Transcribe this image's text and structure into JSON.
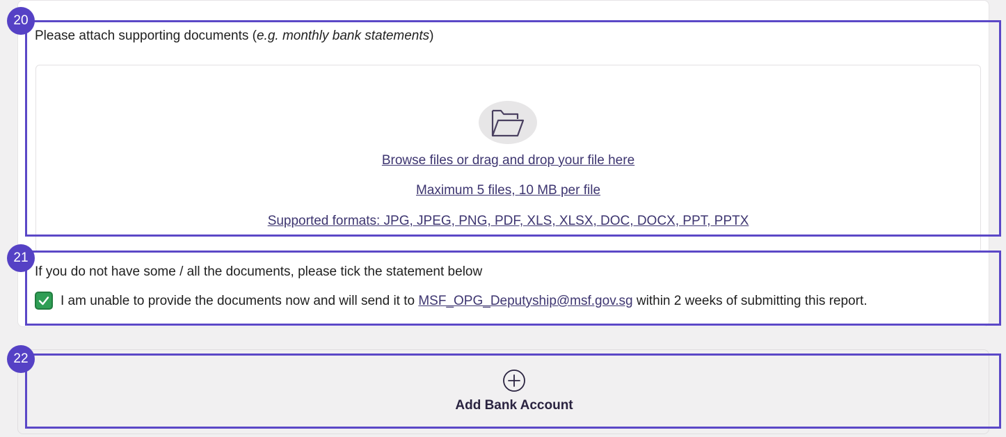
{
  "section20": {
    "badge": "20",
    "attach_label_prefix": "Please attach supporting documents (",
    "attach_label_italic": "e.g. monthly bank statements",
    "attach_label_suffix": ")",
    "dropzone": {
      "icon": "folder-open-icon",
      "browse_link": "Browse files or drag and drop your file here",
      "limits": "Maximum 5 files, 10 MB per file",
      "formats": "Supported formats: JPG, JPEG, PNG, PDF, XLS, XLSX, DOC, DOCX, PPT, PPTX"
    }
  },
  "section21": {
    "badge": "21",
    "instruction": "If you do not have some / all the documents, please tick the statement below",
    "checkbox_checked": true,
    "statement_prefix": "I am unable to provide the documents now and will send it to ",
    "statement_email": "MSF_OPG_Deputyship@msf.gov.sg",
    "statement_suffix": " within 2 weeks of submitting this report."
  },
  "section22": {
    "badge": "22",
    "icon": "plus-circle-icon",
    "button_label": "Add Bank Account"
  },
  "colors": {
    "annotation": "#5b48c7",
    "badge": "#5541c5",
    "link": "#3d3570",
    "checkbox": "#2f9e55",
    "background": "#f1f0f1"
  }
}
